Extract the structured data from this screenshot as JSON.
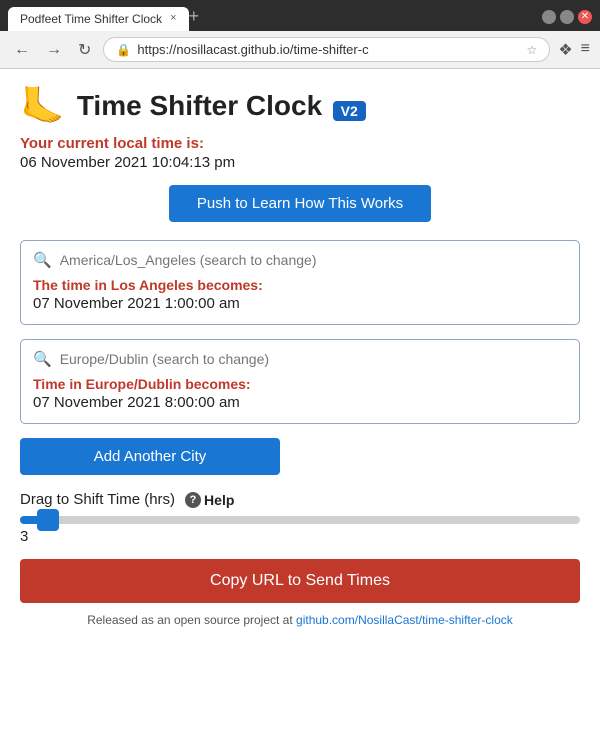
{
  "browser": {
    "tab_label": "Podfeet Time Shifter Clock",
    "tab_close": "×",
    "tab_new": "+",
    "url": "https://nosillacast.github.io/time-shifter-c",
    "win_min": "—",
    "win_max": "□",
    "win_close": "✕"
  },
  "header": {
    "logo": "🦶",
    "title": "Time Shifter Clock",
    "version_badge": "V2"
  },
  "local_time": {
    "label": "Your current local time is:",
    "value": "06 November 2021 10:04:13 pm"
  },
  "learn_button": "Push to Learn How This Works",
  "cities": [
    {
      "search_placeholder": "America/Los_Angeles (search to change)",
      "result_label": "The time in Los Angeles becomes:",
      "result_time": "07 November 2021 1:00:00 am"
    },
    {
      "search_placeholder": "Europe/Dublin (search to change)",
      "result_label": "Time in Europe/Dublin becomes:",
      "result_time": "07 November 2021 8:00:00 am"
    }
  ],
  "add_city_button": "Add Another City",
  "drag_section": {
    "label": "Drag to Shift Time (hrs)",
    "help_label": "Help",
    "slider_value": "3",
    "slider_fill_pct": 7
  },
  "copy_url_button": "Copy URL to Send Times",
  "footer": {
    "text": "Released as an open source project at ",
    "link_text": "github.com/NosillaCast/time-shifter-clock",
    "link_url": "#"
  }
}
